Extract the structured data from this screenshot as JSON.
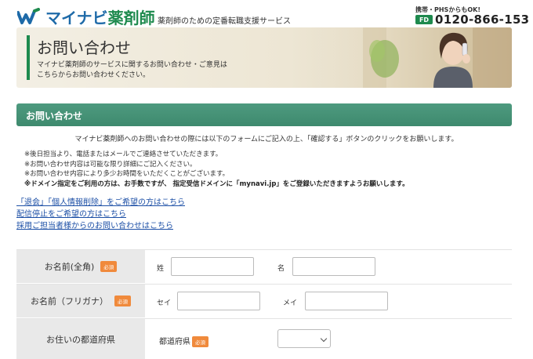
{
  "header": {
    "logo_text_main": "マイナビ",
    "logo_text_accent": "薬剤師",
    "tagline": "薬剤師のための定番転職支援サービス",
    "phone_note": "携帯・PHSからもOK!",
    "phone_icon_label": "FD",
    "phone_number": "0120-866-153"
  },
  "banner": {
    "title": "お問い合わせ",
    "desc_line1": "マイナビ薬剤師のサービスに関するお問い合わせ・ご意見は",
    "desc_line2": "こちらからお問い合わせください。"
  },
  "section": {
    "title": "お問い合わせ"
  },
  "intro": "マイナビ薬剤師へのお問い合わせの際には以下のフォームにご記入の上、「確認する」ボタンのクリックをお願いします。",
  "notes": [
    "※後日担当より、電話またはメールでご連絡させていただきます。",
    "※お問い合わせ内容は可能な限り詳細にご記入ください。",
    "※お問い合わせ内容により多少お時間をいただくことがございます。",
    "※ドメイン指定をご利用の方は、お手数ですが、 指定受信ドメインに「mynavi.jp」をご登録いただきますようお願いします。"
  ],
  "links": [
    "「退会」「個人情報削除」をご希望の方はこちら",
    "配信停止をご希望の方はこちら",
    "採用ご担当者様からのお問い合わせはこちら"
  ],
  "form": {
    "required_badge": "必須",
    "name_label": "お名前(全角)",
    "sei_label": "姓",
    "mei_label": "名",
    "kana_label": "お名前（フリガナ）",
    "kana_sei_label": "セイ",
    "kana_mei_label": "メイ",
    "pref_row_label": "お住いの都道府県",
    "pref_field_label": "都道府県"
  },
  "colors": {
    "brand_blue": "#1e6aa8",
    "brand_green": "#1e8a4e",
    "section_green": "#438f73",
    "required_orange": "#f08a3c",
    "link_blue": "#1c4fa6"
  }
}
